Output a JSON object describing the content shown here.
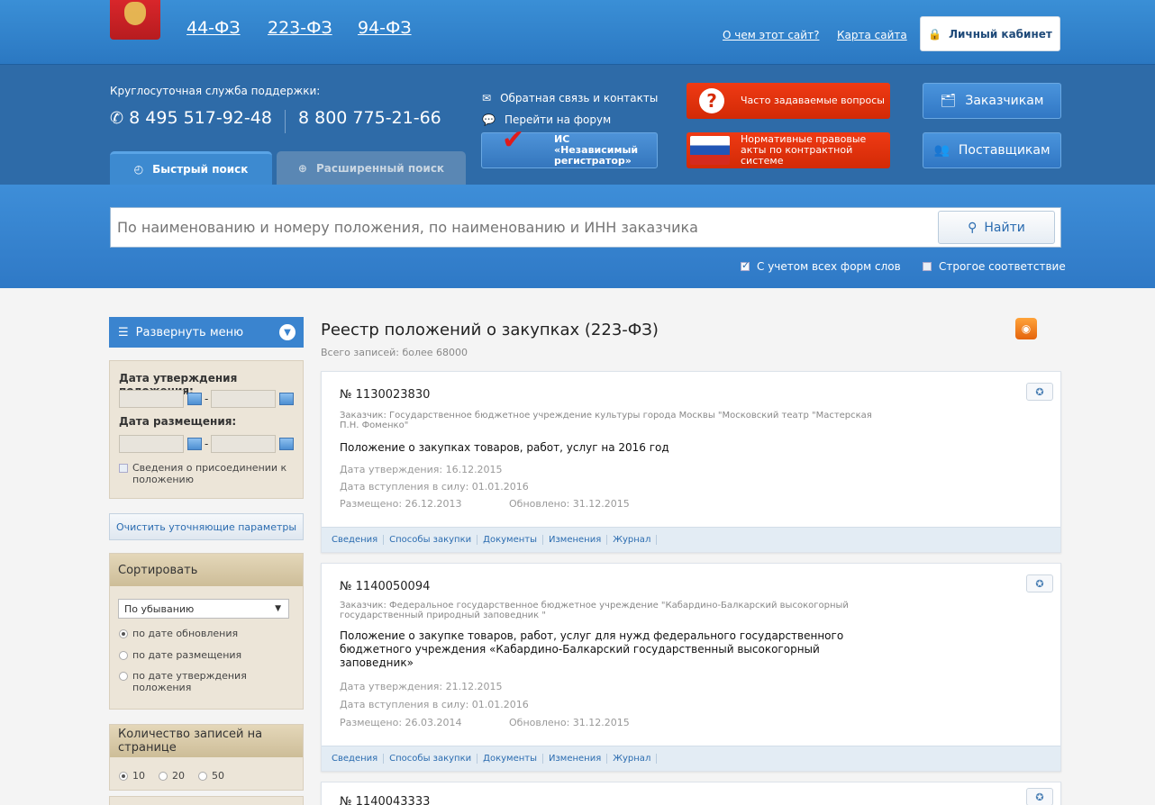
{
  "topbar": {
    "laws": [
      "44-ФЗ",
      "223-ФЗ",
      "94-ФЗ"
    ],
    "about_link": "О чем этот сайт?",
    "sitemap_link": "Карта сайта",
    "cabinet_button": "Личный кабинет"
  },
  "header": {
    "support_label": "Круглосуточная служба поддержки:",
    "phone1": "8 495 517-92-48",
    "phone2": "8 800 775-21-66",
    "feedback_link": "Обратная связь и контакты",
    "forum_link": "Перейти на форум",
    "registrar_button": "ИС «Независимый регистратор»",
    "faq_button": "Часто задаваемые вопросы",
    "npa_button": "Нормативные правовые акты по контрактной системе",
    "customers_button": "Заказчикам",
    "suppliers_button": "Поставщикам",
    "tab_fast": "Быстрый поиск",
    "tab_advanced": "Расширенный поиск"
  },
  "search": {
    "placeholder": "По наименованию и номеру положения, по наименованию и ИНН заказчика",
    "button": "Найти",
    "opt_all_forms": "С учетом всех форм слов",
    "opt_strict": "Строгое соответствие"
  },
  "sidebar": {
    "menu_button": "Развернуть меню",
    "approval_date_label": "Дата утверждения положения:",
    "placement_date_label": "Дата размещения:",
    "join_checkbox": "Сведения о присоединении к положению",
    "clear_button": "Очистить уточняющие параметры",
    "sort_header": "Сортировать",
    "sort_select": "По убыванию",
    "sort_options": [
      "по дате обновления",
      "по дате размещения",
      "по дате утверждения положения"
    ],
    "per_page_header": "Количество записей на странице",
    "per_page_options": [
      "10",
      "20",
      "50"
    ]
  },
  "main": {
    "title": "Реестр положений о закупках (223-ФЗ)",
    "total": "Всего записей: более 68000",
    "tabs": [
      "Сведения",
      "Способы закупки",
      "Документы",
      "Изменения",
      "Журнал"
    ],
    "records": [
      {
        "number": "№ 1130023830",
        "customer": "Заказчик: Государственное бюджетное учреждение культуры города Москвы \"Московский театр \"Мастерская П.Н. Фоменко\"",
        "title": "Положение о закупках товаров, работ, услуг на 2016 год",
        "approved": "Дата утверждения: 16.12.2015",
        "effective": "Дата вступления в силу: 01.01.2016",
        "placed": "Размещено: 26.12.2013",
        "updated": "Обновлено: 31.12.2015"
      },
      {
        "number": "№ 1140050094",
        "customer": "Заказчик: Федеральное государственное бюджетное учреждение \"Кабардино-Балкарский высокогорный государственный природный заповедник \"",
        "title": "Положение о закупке товаров, работ, услуг для нужд федерального государственного бюджетного учреждения «Кабардино-Балкарский государственный высокогорный заповедник»",
        "approved": "Дата утверждения: 21.12.2015",
        "effective": "Дата вступления в силу: 01.01.2016",
        "placed": "Размещено: 26.03.2014",
        "updated": "Обновлено: 31.12.2015"
      },
      {
        "number": "№ 1140043333"
      }
    ]
  }
}
